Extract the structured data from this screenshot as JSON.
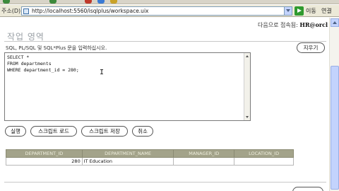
{
  "browser": {
    "address_label": "주소(D)",
    "url": "http://localhost:5560/isqlplus/workspace.uix",
    "go_label": "이동",
    "links_label": "연결"
  },
  "page": {
    "user_info_prefix": "다음으로 접속됨:",
    "user_info_user": "HR@orcl",
    "section_title": "작업 영역",
    "instruction": "SQL, PL/SQL 및 SQL*Plus 문을 입력하십시오.",
    "clear_button": "지우기",
    "editor_text": "SELECT *\nFROM departments\nWHERE department_id = 280;",
    "execute_button": "실행",
    "load_script_button": "스크립트 로드",
    "save_script_button": "스크립트 저장",
    "cancel_button": "취소"
  },
  "results": {
    "columns": [
      "DEPARTMENT_ID",
      "DEPARTMENT_NAME",
      "MANAGER_ID",
      "LOCATION_ID"
    ],
    "rows": [
      [
        "280",
        "IT Education",
        "",
        ""
      ]
    ]
  },
  "colors": {
    "table_header_bg": "#a3a38a",
    "title_gray": "#9aa0a6"
  }
}
